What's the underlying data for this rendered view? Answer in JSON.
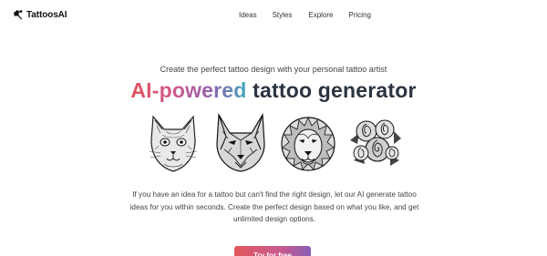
{
  "brand": {
    "name": "TattoosAI"
  },
  "nav": {
    "items": [
      {
        "label": "Ideas"
      },
      {
        "label": "Styles"
      },
      {
        "label": "Explore"
      },
      {
        "label": "Pricing"
      }
    ]
  },
  "hero": {
    "tagline": "Create the perfect tattoo design with your personal tattoo artist",
    "headline_gradient": "AI-powered",
    "headline_rest": "tattoo generator",
    "description": "If you have an idea for a tattoo but can't find the right design, let our AI generate tattoo ideas for you within seconds. Create the perfect design based on what you like, and get unlimited design options.",
    "cta_label": "Try for free"
  },
  "gallery": {
    "images": [
      {
        "icon": "cat-tattoo-icon"
      },
      {
        "icon": "wolf-tattoo-icon"
      },
      {
        "icon": "lion-tattoo-icon"
      },
      {
        "icon": "roses-tattoo-icon"
      }
    ]
  },
  "colors": {
    "gradient_start": "#e0525a",
    "gradient_mid": "#d45a8a",
    "gradient_end": "#3fa8b8",
    "headline_dark": "#2b3440"
  }
}
